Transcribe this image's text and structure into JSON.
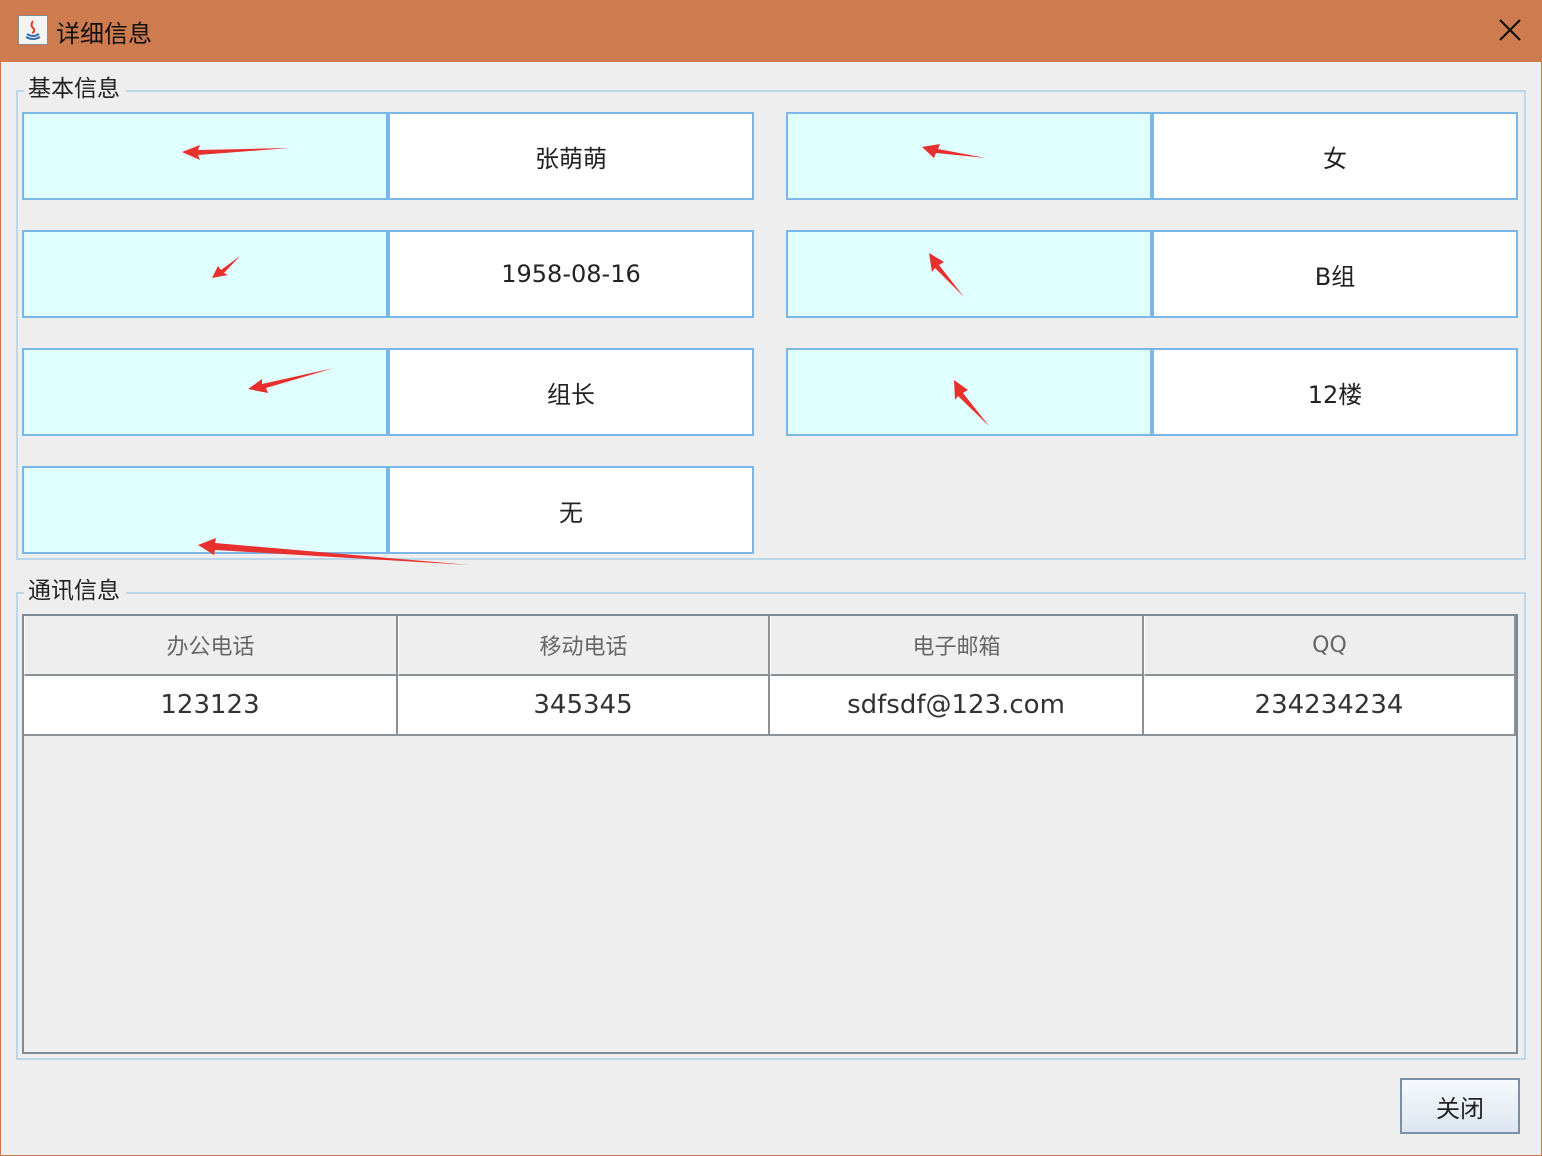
{
  "window": {
    "title": "详细信息",
    "titlebar_color": "#cd7b4f",
    "icons": {
      "app": "java-app-icon",
      "close": "close-icon"
    }
  },
  "basic_info": {
    "group_title": "基本信息",
    "label_bg": "#e0ffff",
    "border_color": "#7ab6e6",
    "values": [
      "张萌萌",
      "女",
      "1958-08-16",
      "B组",
      "组长",
      "12楼",
      "无"
    ]
  },
  "contact_info": {
    "group_title": "通讯信息",
    "columns": [
      "办公电话",
      "移动电话",
      "电子邮箱",
      "QQ"
    ],
    "rows": [
      [
        "123123",
        "345345",
        "sdfsdf@123.com",
        "234234234"
      ]
    ]
  },
  "buttons": {
    "close_label": "关闭"
  },
  "annotations": {
    "arrow_color": "#e8302e"
  }
}
